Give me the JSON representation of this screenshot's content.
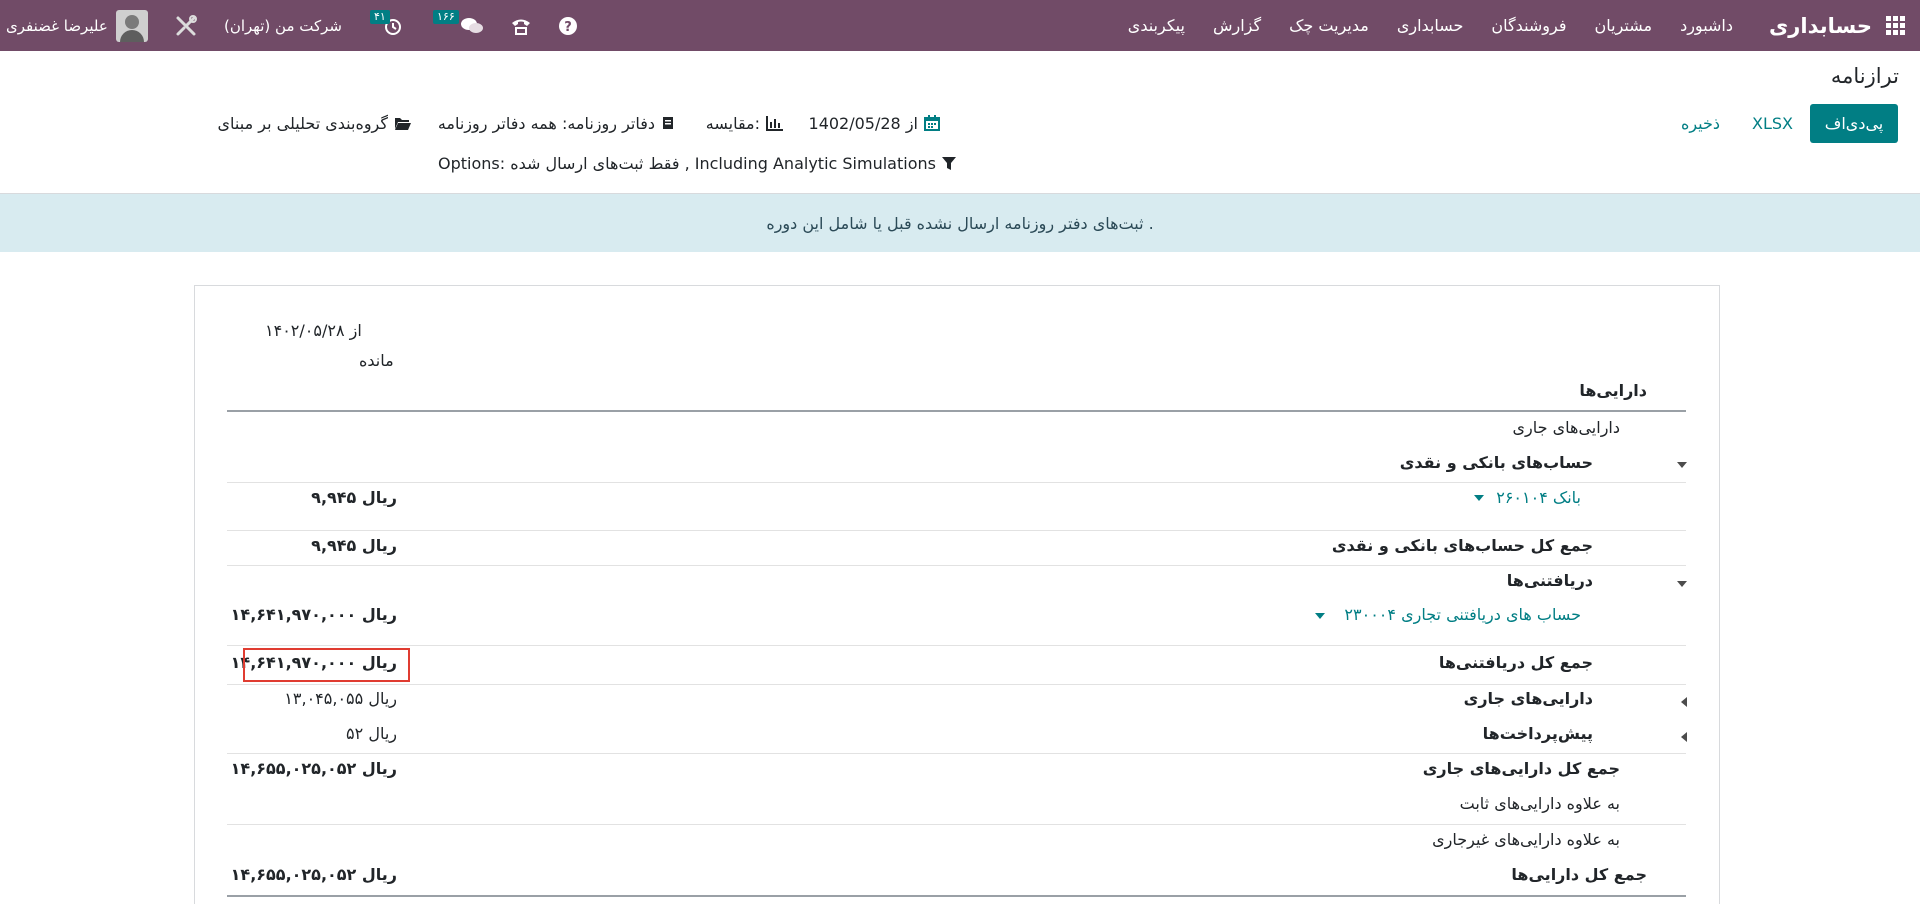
{
  "navbar": {
    "brand": "حسابداری",
    "menu": [
      "داشبورد",
      "مشتریان",
      "فروشندگان",
      "حسابداری",
      "مدیریت چک",
      "گزارش",
      "پیکربندی"
    ],
    "user_name": "علیرضا غضنفری",
    "company": "شرکت من (تهران)",
    "activity_count": "۴۱",
    "messages_count": "۱۶۶",
    "icons": [
      "apps-grid-icon",
      "help-icon",
      "phone-icon",
      "chat-icon",
      "clock-icon",
      "tools-icon"
    ],
    "bg_color": "#714B67"
  },
  "control_panel": {
    "title": "ترازنامه",
    "pdf_label": "پی‌دی‌اف",
    "xlsx_label": "XLSX",
    "save_label": "ذخیره",
    "date_filter": "از 1402/05/28",
    "comparison_filter": "مقایسه:",
    "journals_filter": "دفاتر روزنامه: همه دفاتر روزنامه",
    "analytic_filter": "گروه‌بندی تحلیلی بر مبنای",
    "options_filter": "Options: فقط ثبت‌های ارسال شده , Including Analytic Simulations",
    "accent_color": "#017e84"
  },
  "alert": {
    "text": ". ثبت‌های دفتر روزنامه ارسال نشده قبل یا شامل این دوره"
  },
  "report": {
    "column_header_line1": "از ۱۴۰۲/۰۵/۲۸",
    "column_header_line2": "مانده",
    "rows": [
      {
        "label": "دارایی‌ها",
        "value": ""
      },
      {
        "label": "دارایی‌های جاری",
        "value": ""
      },
      {
        "label": "حساب‌های بانکی و نقدی",
        "value": ""
      },
      {
        "label": "۲۶۰۱۰۴ بانک",
        "value": "۹,۹۴۵ ریال"
      },
      {
        "label": "جمع کل حساب‌های بانکی و نقدی",
        "value": "۹,۹۴۵ ریال"
      },
      {
        "label": "دریافتنی‌ها",
        "value": ""
      },
      {
        "label": "۲۳۰۰۰۴ حساب های دریافتنی تجاری",
        "value": "۱۴,۶۴۱,۹۷۰,۰۰۰ ریال"
      },
      {
        "label": "جمع کل دریافتنی‌ها",
        "value": "۱۴,۶۴۱,۹۷۰,۰۰۰ ریال"
      },
      {
        "label": "دارایی‌های جاری",
        "value": "۱۳,۰۴۵,۰۵۵ ریال"
      },
      {
        "label": "پیش‌پرداخت‌ها",
        "value": "۵۲ ریال"
      },
      {
        "label": "جمع کل دارایی‌های جاری",
        "value": "۱۴,۶۵۵,۰۲۵,۰۵۲ ریال"
      },
      {
        "label": "به علاوه دارایی‌های ثابت",
        "value": ""
      },
      {
        "label": "به علاوه دارایی‌های غیرجاری",
        "value": ""
      },
      {
        "label": "جمع کل دارایی‌ها",
        "value": "۱۴,۶۵۵,۰۲۵,۰۵۲ ریال"
      }
    ]
  }
}
